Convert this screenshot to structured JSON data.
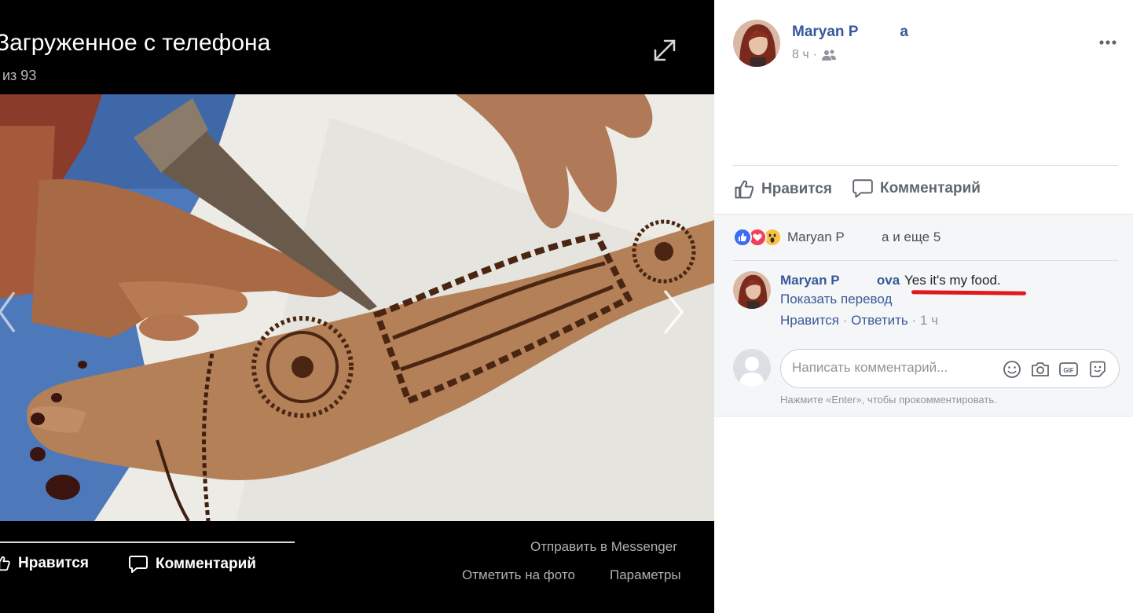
{
  "viewer": {
    "title": "Загруженное с телефона",
    "counter": "из 93",
    "like_label": "Нравится",
    "comment_label": "Комментарий",
    "send_messenger": "Отправить в Messenger",
    "tag_photo": "Отметить на фото",
    "options": "Параметры"
  },
  "post": {
    "author_name": "Maryan P     a",
    "time": "8 ч",
    "audience_icon": "friends-icon",
    "more_icon": "more-icon"
  },
  "actions": {
    "like": "Нравится",
    "comment": "Комментарий"
  },
  "reactions": {
    "icons": [
      "like-reaction-icon",
      "love-reaction-icon",
      "wow-reaction-icon"
    ],
    "colors": {
      "like": "#3b6cf5",
      "love": "#f33e58",
      "wow": "#fcc13e"
    },
    "summary": "Maryan P     a и еще 5"
  },
  "comment": {
    "author": "Maryan P     ova",
    "text": "Yes it's my food.",
    "translate": "Показать перевод",
    "like": "Нравится",
    "separator": " · ",
    "reply": "Ответить",
    "time": "1 ч"
  },
  "write_comment": {
    "placeholder": "Написать комментарий...",
    "icons": [
      "emoji-icon",
      "camera-icon",
      "gif-icon",
      "sticker-icon"
    ],
    "hint": "Нажмите «Enter», чтобы прокомментировать."
  },
  "colors": {
    "link": "#365899",
    "underline": "#e0191e",
    "muted": "#90949c"
  }
}
